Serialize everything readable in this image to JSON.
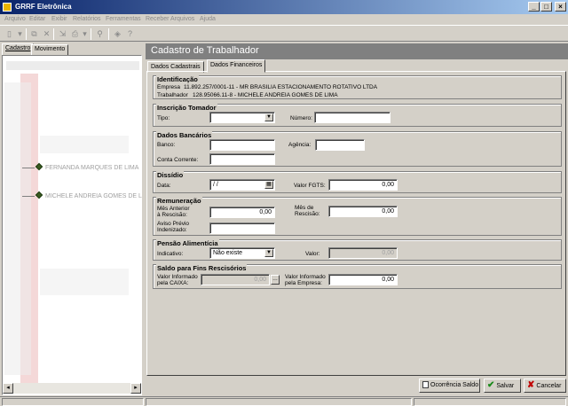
{
  "window": {
    "title": "GRRF Eletrônica"
  },
  "menu": [
    "Arquivo",
    "Editar",
    "Exibir",
    "Relatórios",
    "Ferramentas",
    "Receber Arquivos",
    "Ajuda"
  ],
  "left_tabs": [
    "Cadastro",
    "Movimento"
  ],
  "tree": [
    "FERNANDA MARQUES DE LIMA",
    "MICHELE ANDREIA GOMES DE L"
  ],
  "header": {
    "title": "Cadastro de Trabalhador"
  },
  "form_tabs": [
    "Dados Cadastrais",
    "Dados Financeiros"
  ],
  "identificacao": {
    "title": "Identificação",
    "empresa_label": "Empresa",
    "empresa_value": "11.892.257/0001-11 - MR BRASILIA ESTACIONAMENTO ROTATIVO LTDA",
    "trabalhador_label": "Trabalhador",
    "trabalhador_value": "128.95066.11-8 - MICHELE ANDREIA GOMES DE LIMA"
  },
  "inscricao": {
    "title": "Inscrição Tomador",
    "tipo_label": "Tipo:",
    "tipo_value": "",
    "numero_label": "Número:",
    "numero_value": ""
  },
  "bancarios": {
    "title": "Dados Bancários",
    "banco_label": "Banco:",
    "agencia_label": "Agência:",
    "conta_label": "Conta Corrente:"
  },
  "dissidio": {
    "title": "Dissídio",
    "data_label": "Data:",
    "data_value": "/ /",
    "fgts_label": "Valor FGTS:",
    "fgts_value": "0,00"
  },
  "remuneracao": {
    "title": "Remuneração",
    "mes_anterior_label_1": "Mês Anterior",
    "mes_anterior_label_2": "à Rescisão:",
    "mes_anterior_value": "0,00",
    "mes_rescisao_label_1": "Mês de",
    "mes_rescisao_label_2": "Rescisão:",
    "mes_rescisao_value": "0,00",
    "aviso_label_1": "Aviso Prévio",
    "aviso_label_2": "Indenizado:",
    "aviso_value": ""
  },
  "pensao": {
    "title": "Pensão Alimentícia",
    "indicativo_label": "Indicativo:",
    "indicativo_value": "Não existe",
    "valor_label": "Valor:",
    "valor_value": "0,00"
  },
  "saldo": {
    "title": "Saldo para Fins Rescisórios",
    "caixa_label_1": "Valor Informado",
    "caixa_label_2": "pela CAIXA:",
    "caixa_value": "0,00",
    "empresa_label_1": "Valor Informado",
    "empresa_label_2": "pela Empresa:",
    "empresa_value": "0,00"
  },
  "buttons": {
    "ocorrencia": "Ocorrência Saldo",
    "salvar": "Salvar",
    "cancelar": "Cancelar"
  },
  "colors": {
    "title_start": "#0a246a",
    "title_end": "#a6caf0",
    "header_bg": "#808080",
    "save_check": "#1a8a1a",
    "cancel_x": "#c00000"
  }
}
